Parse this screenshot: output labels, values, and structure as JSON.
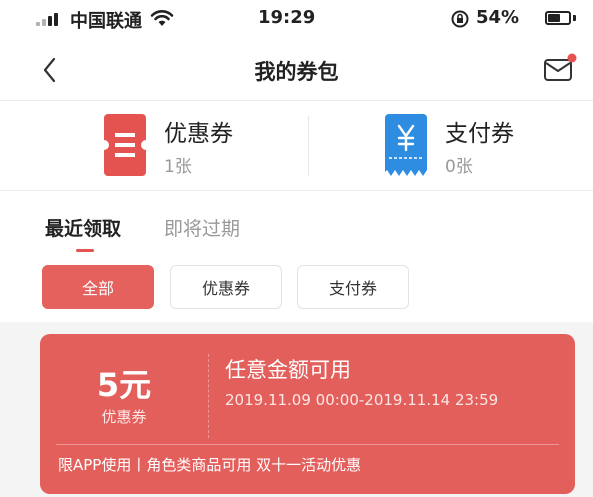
{
  "status_bar": {
    "carrier": "中国联通",
    "time": "19:29",
    "battery": "54%",
    "battery_level": 0.54
  },
  "nav": {
    "title": "我的券包",
    "back_icon": "chevron-left-icon",
    "message_icon": "mail-icon",
    "has_unread_dot": true
  },
  "summary": {
    "items": [
      {
        "name": "优惠券",
        "count": "1张",
        "icon": "coupon-ticket-icon",
        "color": "#e4534f"
      },
      {
        "name": "支付券",
        "count": "0张",
        "icon": "yen-ticket-icon",
        "color": "#2e8de0"
      }
    ]
  },
  "tabs": [
    {
      "label": "最近领取",
      "active": true
    },
    {
      "label": "即将过期",
      "active": false
    }
  ],
  "filters": [
    {
      "label": "全部",
      "active": true
    },
    {
      "label": "优惠券",
      "active": false
    },
    {
      "label": "支付券",
      "active": false
    }
  ],
  "coupons": [
    {
      "amount": "5元",
      "type": "优惠券",
      "title": "任意金额可用",
      "period": "2019.11.09 00:00-2019.11.14 23:59",
      "note": "限APP使用丨角色类商品可用 双十一活动优惠"
    }
  ],
  "colors": {
    "accent": "#e4534f",
    "card_bg": "#e35f5c",
    "pay_blue": "#2e8de0"
  }
}
